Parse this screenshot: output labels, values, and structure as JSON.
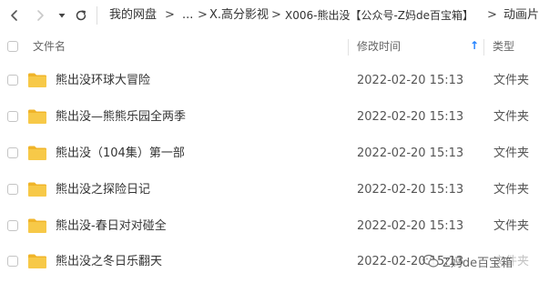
{
  "breadcrumb": {
    "items": [
      "我的网盘",
      "...",
      "X.高分影视",
      "X006-熊出没【公众号-Z妈de百宝箱】",
      "动画片"
    ],
    "separator": ">"
  },
  "header": {
    "name_label": "文件名",
    "modified_label": "修改时间",
    "type_label": "类型",
    "sort_direction": "ascending",
    "sort_arrow": "↑"
  },
  "files": [
    {
      "name": "熊出没环球大冒险",
      "modified": "2022-02-20 15:13",
      "type": "文件夹"
    },
    {
      "name": "熊出没—熊熊乐园全两季",
      "modified": "2022-02-20 15:13",
      "type": "文件夹"
    },
    {
      "name": "熊出没（104集）第一部",
      "modified": "2022-02-20 15:13",
      "type": "文件夹"
    },
    {
      "name": "熊出没之探险日记",
      "modified": "2022-02-20 15:13",
      "type": "文件夹"
    },
    {
      "name": "熊出没-春日对对碰全",
      "modified": "2022-02-20 15:13",
      "type": "文件夹"
    },
    {
      "name": "熊出没之冬日乐翻天",
      "modified": "2022-02-20 15:13",
      "type": "文件夹"
    }
  ],
  "watermark": {
    "text": "Z妈de百宝箱"
  },
  "colors": {
    "folder": "#f7c948",
    "folder_back": "#f0b429",
    "sort_arrow": "#1e80ff",
    "text": "#333333",
    "muted": "#666666"
  },
  "icons": {
    "back": "chevron-left-icon",
    "forward": "chevron-right-icon",
    "history": "caret-down-icon",
    "refresh": "refresh-icon",
    "folder": "folder-icon",
    "watermark": "wechat-icon"
  }
}
